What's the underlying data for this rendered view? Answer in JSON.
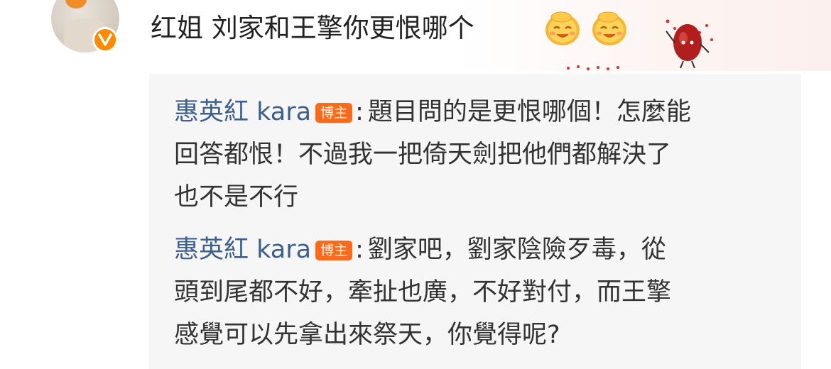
{
  "comment": {
    "text": "红姐 刘家和王擎你更恨哪个",
    "emoji_name": "gold-nugget-smile-emoji",
    "emoji_caption": "金疙瘩",
    "avatar_icon": "user-avatar",
    "badge_label": "V"
  },
  "replies": [
    {
      "username": "惠英紅 kara",
      "tag": "博主",
      "colon": ":",
      "lines": [
        "題目問的是更恨哪個！怎麼能",
        "回答都恨！不過我一把倚天劍把他們都解決了",
        "也不是不行"
      ]
    },
    {
      "username": "惠英紅 kara",
      "tag": "博主",
      "colon": ":",
      "lines": [
        "劉家吧，劉家陰險歹毒，從",
        "頭到尾都不好，牽扯也廣，不好對付，而王擎",
        "感覺可以先拿出來祭天，你覺得呢?"
      ]
    }
  ],
  "colors": {
    "username": "#3d5f8e",
    "tag_bg": "#ff6a1a",
    "verified_badge": "#ff8a00"
  }
}
